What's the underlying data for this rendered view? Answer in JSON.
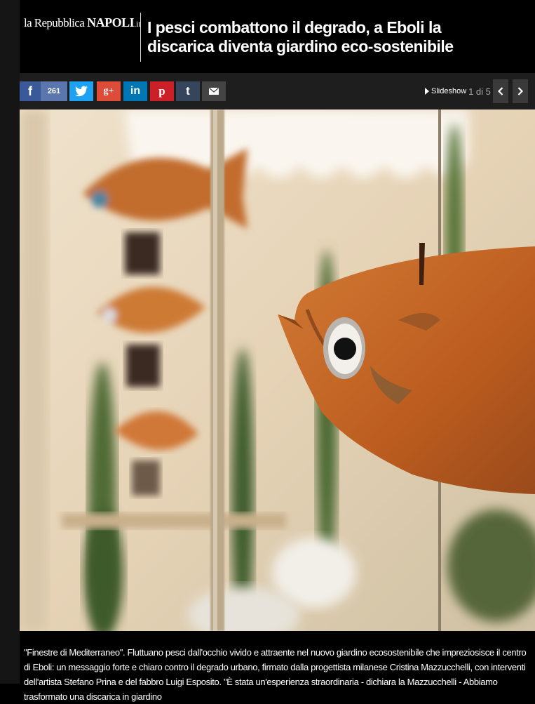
{
  "brand": {
    "prefix": "la Repubblica",
    "city": "NAPOLI",
    "suffix": ".it"
  },
  "article": {
    "title": "I pesci combattono il degrado, a Eboli la discarica diventa giardino eco-sostenibile"
  },
  "share": {
    "facebook_icon": "f",
    "facebook_count": "261",
    "googleplus_label": "g+",
    "linkedin_label": "in",
    "pinterest_label": "p",
    "tumblr_label": "t",
    "icons": [
      "facebook-icon",
      "twitter-icon",
      "googleplus-icon",
      "linkedin-icon",
      "pinterest-icon",
      "tumblr-icon",
      "mail-icon"
    ]
  },
  "gallery": {
    "slideshow_label": "Slideshow",
    "counter": "1 di 5"
  },
  "caption": "\"Finestre di Mediterraneo\". Fluttuano pesci dall'occhio vivido e attraente nel nuovo giardino ecosostenibile che impreziosisce il centro di Eboli: un messaggio forte e chiaro contro il degrado urbano, firmato dalla progettista milanese Cristina Mazzucchelli, con interventi dell'artista Stefano Prina e del fabbro Luigi Esposito. \"È stata un'esperienza straordinaria - dichiara la Mazzucchelli - Abbiamo trasformato una discarica in giardino",
  "colors": {
    "facebook": "#3b5998",
    "twitter": "#1da1f2",
    "googleplus": "#dd4b39",
    "linkedin": "#0077b5",
    "pinterest": "#cb2027",
    "tumblr": "#35465c",
    "fish": "#c8692a"
  }
}
